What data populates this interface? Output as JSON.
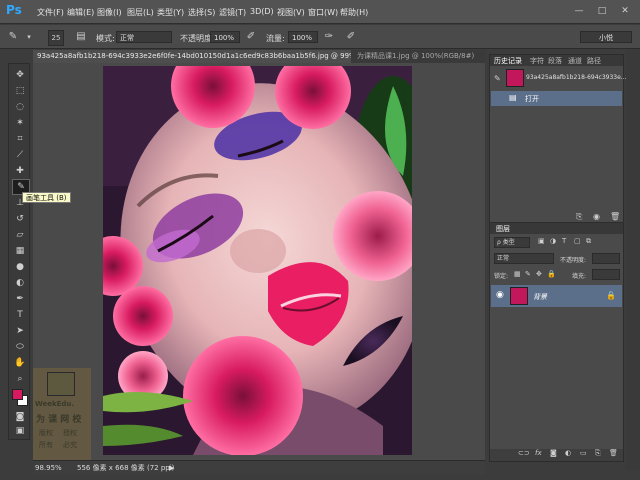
{
  "app": {
    "logo": "Ps",
    "menu": [
      "文件(F)",
      "编辑(E)",
      "图像(I)",
      "图层(L)",
      "类型(Y)",
      "选择(S)",
      "滤镜(T)",
      "3D(D)",
      "视图(V)",
      "窗口(W)",
      "帮助(H)"
    ],
    "window_buttons": [
      "—",
      "□",
      "✕"
    ]
  },
  "options": {
    "brush_size": "25",
    "mode_label": "模式:",
    "mode_value": "正常",
    "opacity_label": "不透明度:",
    "opacity_value": "100%",
    "flow_label": "流量:",
    "flow_value": "100%",
    "workspace": "小悦"
  },
  "tabs": [
    {
      "label": "93a425a8afb1b218-694c3933e2e6f0fe-14bd010150d1a1c6ed9c83b6baa1b5f6.jpg @ 99%(RGB/8#)",
      "close": "×",
      "active": true
    },
    {
      "label": "为课精品课1.jpg @ 100%(RGB/8#)",
      "close": "×",
      "active": false
    }
  ],
  "tooltip": "画笔工具 (B)",
  "status": {
    "zoom": "98.95%",
    "doc_info": "556 像素 x 668 像素 (72 ppi)",
    "arrow": "▶"
  },
  "watermark": {
    "brand": "WeekEdu.",
    "slogan": "为 课 网 校",
    "rights": [
      "版权",
      "所有",
      "授权",
      "必究"
    ]
  },
  "history_panel": {
    "tabs": [
      "历史记录",
      "字符",
      "段落",
      "通道",
      "路径"
    ],
    "snapshot_label": "93a425a8afb1b218-694c3933e...",
    "items": [
      {
        "label": "打开"
      }
    ]
  },
  "layers_panel": {
    "tab": "图层",
    "filter_label": "ρ 类型",
    "blend_mode": "正常",
    "opacity_label": "不透明度:",
    "lock_label": "锁定:",
    "fill_label": "填充:",
    "layers": [
      {
        "name": "背景",
        "locked": true
      }
    ]
  },
  "colors": {
    "foreground": "#d81b60",
    "background": "#ffffff",
    "selection": "#5b6f8a",
    "ps_blue": "#31a8ff"
  }
}
